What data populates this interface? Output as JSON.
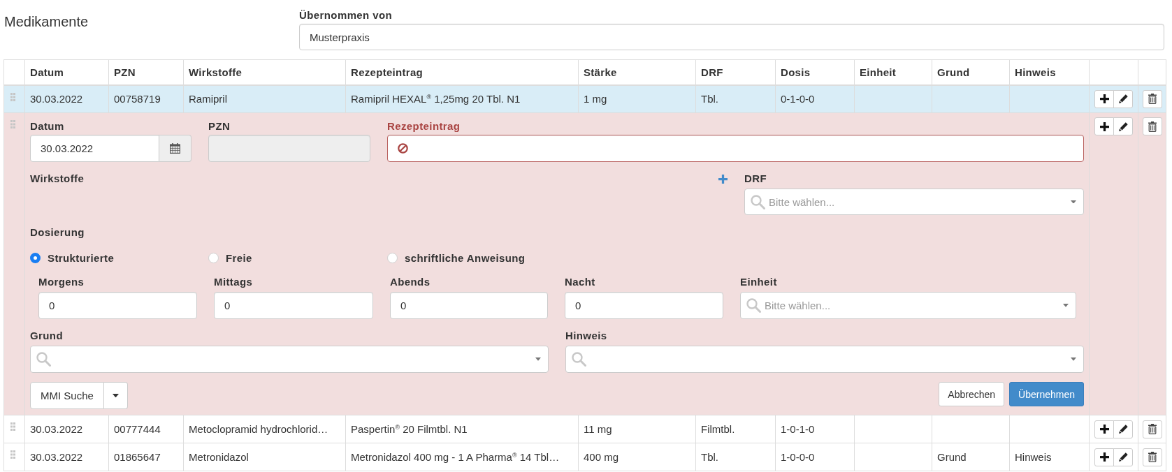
{
  "title": "Medikamente",
  "source": {
    "label": "Übernommen von",
    "value": "Musterpraxis"
  },
  "table": {
    "columns": [
      "Datum",
      "PZN",
      "Wirkstoffe",
      "Rezepteintrag",
      "Stärke",
      "DRF",
      "Dosis",
      "Einheit",
      "Grund",
      "Hinweis"
    ],
    "rows": [
      {
        "kind": "data",
        "selected": true,
        "cells": [
          "30.03.2022",
          "00758719",
          "Ramipril",
          "Ramipril HEXAL$^{®}$ 1,25mg 20 Tbl. N1",
          "1 mg",
          "Tbl.",
          "0-1-0-0",
          null,
          null,
          null
        ]
      },
      {
        "kind": "editor",
        "selected": false,
        "form": {
          "fields": [
            {
              "kind": "date",
              "label": "Datum",
              "value": "30.03.2022",
              "disabled": false,
              "error": false
            },
            {
              "kind": "text",
              "label": "PZN",
              "disabled": true,
              "error": false
            },
            {
              "kind": "text",
              "label": "Rezepteintrag",
              "disabled": false,
              "error": true
            }
          ],
          "wirkstoffe": {
            "label": "Wirkstoffe"
          },
          "drf": {
            "label": "DRF",
            "placeholder": "Bitte wählen..."
          },
          "dosierung": {
            "label": "Dosierung",
            "options": [
              {
                "label": "Strukturierte",
                "selected": true
              },
              {
                "label": "Freie",
                "selected": false
              },
              {
                "label": "schriftliche Anweisung",
                "selected": false
              }
            ]
          },
          "doses": [
            {
              "label": "Morgens",
              "value": "0"
            },
            {
              "label": "Mittags",
              "value": "0"
            },
            {
              "label": "Abends",
              "value": "0"
            },
            {
              "label": "Nacht",
              "value": "0"
            }
          ],
          "einheit": {
            "label": "Einheit",
            "placeholder": "Bitte wählen..."
          },
          "grund": {
            "label": "Grund"
          },
          "hinweis": {
            "label": "Hinweis"
          },
          "search_button": {
            "label": "MMI Suche"
          },
          "buttons": [
            {
              "label": "Abbrechen",
              "kind": "default"
            },
            {
              "label": "Übernehmen",
              "kind": "primary"
            }
          ]
        }
      },
      {
        "kind": "data",
        "selected": false,
        "cells": [
          "30.03.2022",
          "00777444",
          "Metoclopramid hydrochlorid…",
          "Paspertin$^{®}$ 20 Filmtbl. N1",
          "11 mg",
          "Filmtbl.",
          "1-0-1-0",
          null,
          null,
          null
        ]
      },
      {
        "kind": "data",
        "selected": false,
        "cells": [
          "30.03.2022",
          "01865647",
          "Metronidazol",
          "Metronidazol 400 mg - 1 A Pharma$^{®}$ 14 Tbl…",
          "400 mg",
          "Tbl.",
          "1-0-0-0",
          null,
          "Grund",
          "Hinweis"
        ]
      }
    ]
  }
}
